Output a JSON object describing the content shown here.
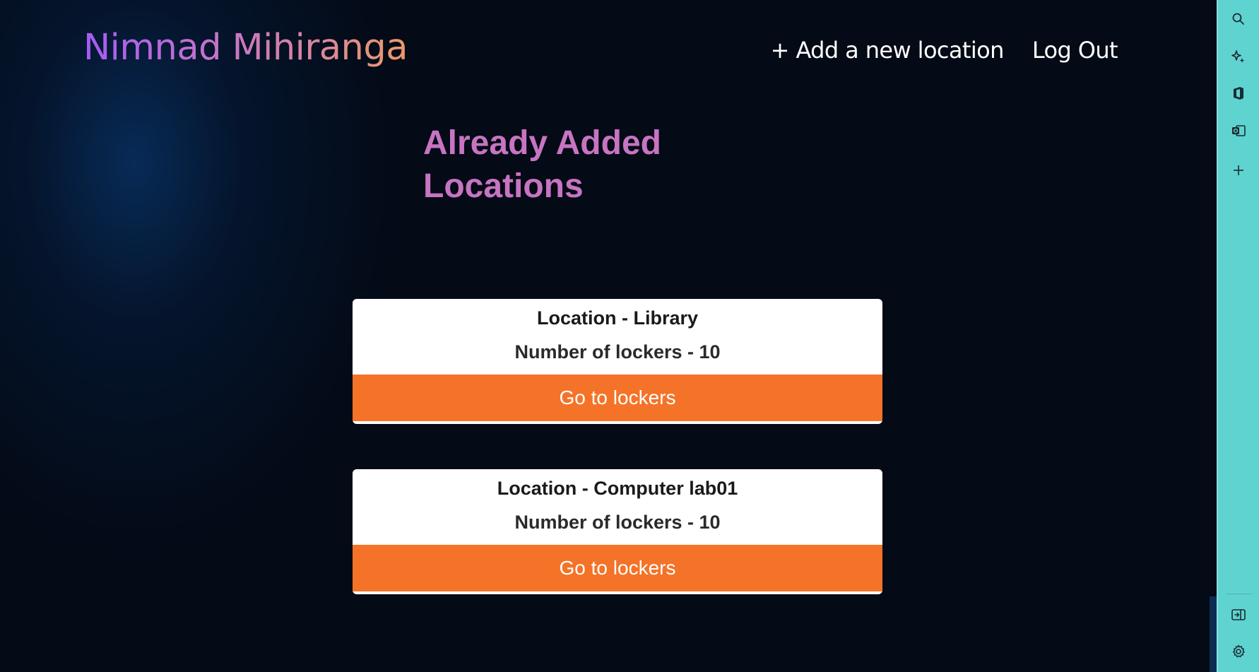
{
  "header": {
    "brand": "Nimnad Mihiranga",
    "nav": {
      "add_location": "+ Add a new location",
      "logout": "Log Out"
    }
  },
  "main": {
    "heading": "Already Added Locations",
    "locations": [
      {
        "title": "Location - Library",
        "count": "Number of lockers - 10",
        "button": "Go to lockers"
      },
      {
        "title": "Location - Computer lab01",
        "count": "Number of lockers - 10",
        "button": "Go to lockers"
      }
    ]
  },
  "sidebar": {
    "icons": [
      "search-icon",
      "sparkle-icon",
      "office-icon",
      "outlook-icon",
      "plus-icon",
      "panel-icon",
      "gear-icon"
    ]
  },
  "colors": {
    "background": "#040a16",
    "heading": "#c774c2",
    "button": "#f47328",
    "sidebar": "#5fd3cf"
  }
}
